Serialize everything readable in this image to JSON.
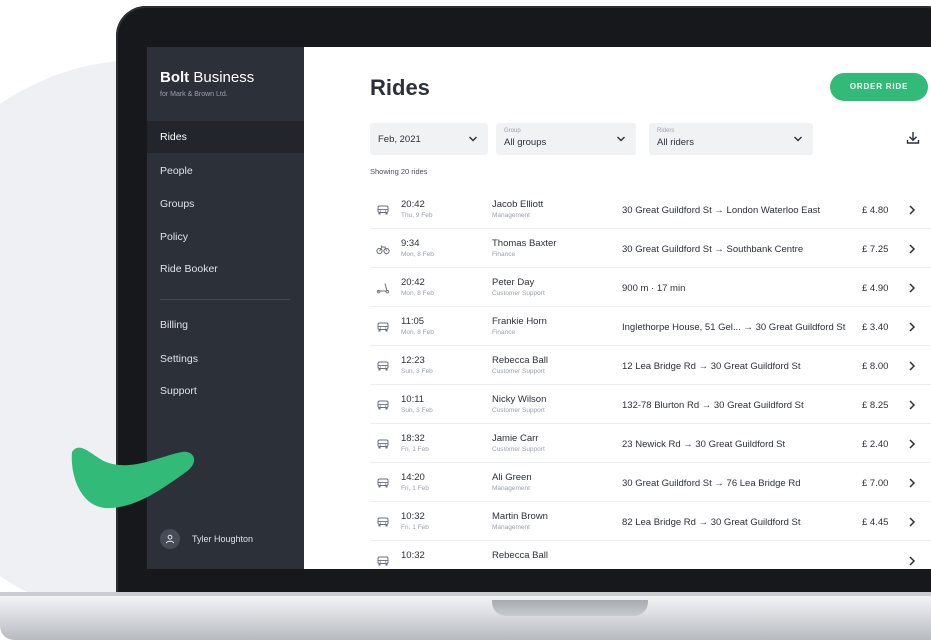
{
  "brand": {
    "logo": "Bolt",
    "name": "Business",
    "subtitle": "for Mark & Brown Ltd."
  },
  "colors": {
    "accent": "#32bb78",
    "sidebar": "#2c3039",
    "text": "#2c3039",
    "muted": "#9aa0ab"
  },
  "sidebar": {
    "items": [
      {
        "label": "Rides",
        "active": true
      },
      {
        "label": "People"
      },
      {
        "label": "Groups"
      },
      {
        "label": "Policy"
      },
      {
        "label": "Ride Booker"
      },
      {
        "label": "Billing"
      },
      {
        "label": "Settings"
      },
      {
        "label": "Support"
      }
    ],
    "user": {
      "name": "Tyler Houghton",
      "icon": "user-icon"
    }
  },
  "main": {
    "title": "Rides",
    "order_button": "ORDER RIDE",
    "filters": {
      "period": {
        "value": "Feb, 2021"
      },
      "group": {
        "label": "Group",
        "value": "All groups"
      },
      "riders": {
        "label": "Riders",
        "value": "All riders"
      }
    },
    "download_icon": "download-icon",
    "count": "Showing 20 rides",
    "rides": [
      {
        "icon": "car",
        "time": "20:42",
        "date": "Thu, 9 Feb",
        "name": "Jacob Elliott",
        "team": "Management",
        "route": "30 Great Guildford St → London Waterloo East",
        "price": "£ 4.80"
      },
      {
        "icon": "bike",
        "time": "9:34",
        "date": "Mon, 8 Feb",
        "name": "Thomas Baxter",
        "team": "Finance",
        "route": "30 Great Guildford St → Southbank Centre",
        "price": "£ 7.25"
      },
      {
        "icon": "scooter",
        "time": "20:42",
        "date": "Mon, 8 Feb",
        "name": "Peter Day",
        "team": "Customer Support",
        "route": "900 m · 17 min",
        "price": "£ 4.90"
      },
      {
        "icon": "car",
        "time": "11:05",
        "date": "Mon, 8 Feb",
        "name": "Frankie Horn",
        "team": "Finance",
        "route": "Inglethorpe House, 51 Gel... → 30 Great Guildford St",
        "price": "£ 3.40"
      },
      {
        "icon": "car",
        "time": "12:23",
        "date": "Sun, 3 Feb",
        "name": "Rebecca Ball",
        "team": "Customer Support",
        "route": "12 Lea Bridge Rd → 30 Great Guildford St",
        "price": "£ 8.00"
      },
      {
        "icon": "car",
        "time": "10:11",
        "date": "Sun, 3 Feb",
        "name": "Nicky Wilson",
        "team": "Customer Support",
        "route": "132-78 Blurton Rd → 30 Great Guildford St",
        "price": "£ 8.25"
      },
      {
        "icon": "car",
        "time": "18:32",
        "date": "Fri, 1 Feb",
        "name": "Jamie Carr",
        "team": "Customer Support",
        "route": "23 Newick Rd → 30 Great Guildford St",
        "price": "£ 2.40"
      },
      {
        "icon": "car",
        "time": "14:20",
        "date": "Fri, 1 Feb",
        "name": "Ali Green",
        "team": "Management",
        "route": "30 Great Guildford St → 76 Lea Bridge Rd",
        "price": "£ 7.00"
      },
      {
        "icon": "car",
        "time": "10:32",
        "date": "Fri, 1 Feb",
        "name": "Martin Brown",
        "team": "Management",
        "route": "82 Lea Bridge Rd → 30 Great Guildford St",
        "price": "£ 4.45"
      },
      {
        "icon": "car",
        "time": "10:32",
        "date": "",
        "name": "Rebecca Ball",
        "team": "",
        "route": "",
        "price": ""
      }
    ]
  }
}
